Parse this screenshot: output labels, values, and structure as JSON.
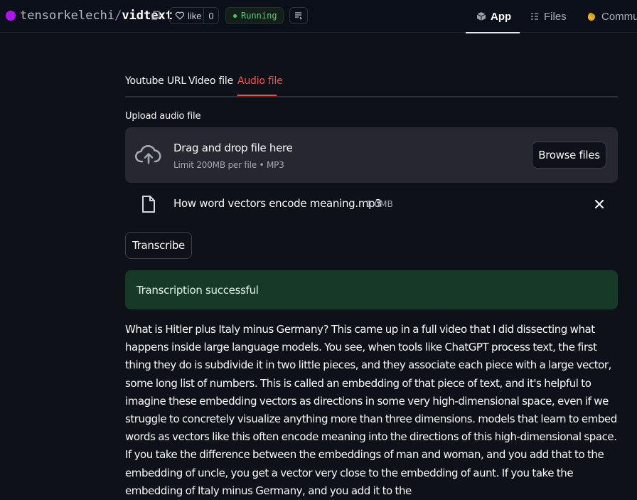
{
  "header": {
    "owner": "tensorkelechi",
    "separator": "/",
    "repo": "vidtext",
    "like_label": "like",
    "like_count": "0",
    "status": "Running",
    "nav": [
      {
        "label": "App",
        "icon": "cube-icon"
      },
      {
        "label": "Files",
        "icon": "files-icon"
      },
      {
        "label": "Commu",
        "icon": "community-icon"
      }
    ],
    "colors": {
      "space_dot": "#b012f5",
      "status": "#3fd07c"
    }
  },
  "tabs": [
    {
      "label": "Youtube URL",
      "active": false
    },
    {
      "label": "Video file",
      "active": false
    },
    {
      "label": "Audio file",
      "active": true
    }
  ],
  "uploader": {
    "label": "Upload audio file",
    "drop_text": "Drag and drop file here",
    "limit_text": "Limit 200MB per file • MP3",
    "browse_label": "Browse files",
    "file_name": "How word vectors encode meaning.mp3",
    "file_size": "1.0MB"
  },
  "transcribe_label": "Transcribe",
  "alert": {
    "text": "Transcription successful",
    "color": "#173928"
  },
  "transcript": "What is Hitler plus Italy minus Germany? This came up in a full video that I did dissecting what happens inside large language models. You see, when tools like ChatGPT process text, the first thing they do is subdivide it in two little pieces, and they associate each piece with a large vector, some long list of numbers. This is called an embedding of that piece of text, and it's helpful to imagine these embedding vectors as directions in some very high-dimensional space, even if we struggle to concretely visualize anything more than three dimensions. models that learn to embed words as vectors like this often encode meaning into the directions of this high-dimensional space. If you take the difference between the embeddings of man and woman, and you add that to the embedding of uncle, you get a vector very close to the embedding of aunt. If you take the embedding of Italy minus Germany, and you add it to the",
  "accent": "#ff4b4b"
}
